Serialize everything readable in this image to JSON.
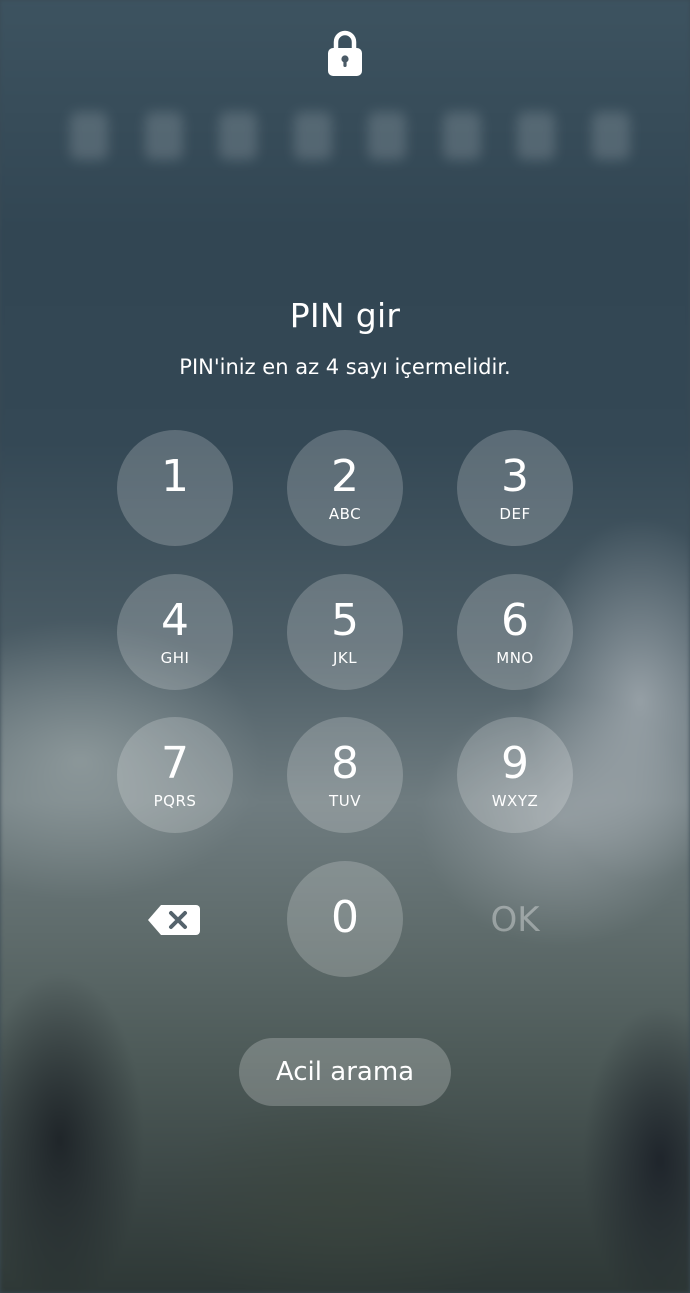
{
  "lockscreen": {
    "title": "PIN gir",
    "subtitle": "PIN'iniz en az 4 sayı içermelidir."
  },
  "keypad": {
    "keys": [
      {
        "digit": "1",
        "letters": ""
      },
      {
        "digit": "2",
        "letters": "ABC"
      },
      {
        "digit": "3",
        "letters": "DEF"
      },
      {
        "digit": "4",
        "letters": "GHI"
      },
      {
        "digit": "5",
        "letters": "JKL"
      },
      {
        "digit": "6",
        "letters": "MNO"
      },
      {
        "digit": "7",
        "letters": "PQRS"
      },
      {
        "digit": "8",
        "letters": "TUV"
      },
      {
        "digit": "9",
        "letters": "WXYZ"
      },
      {
        "digit": "0",
        "letters": ""
      }
    ],
    "delete_icon": "backspace-icon",
    "ok_label": "OK"
  },
  "emergency": {
    "label": "Acil arama"
  },
  "icons": {
    "top": "lock-icon"
  },
  "colors": {
    "text": "#ffffff",
    "key_fill": "rgba(255,255,255,0.20)",
    "ok_disabled": "rgba(255,255,255,0.35)"
  }
}
